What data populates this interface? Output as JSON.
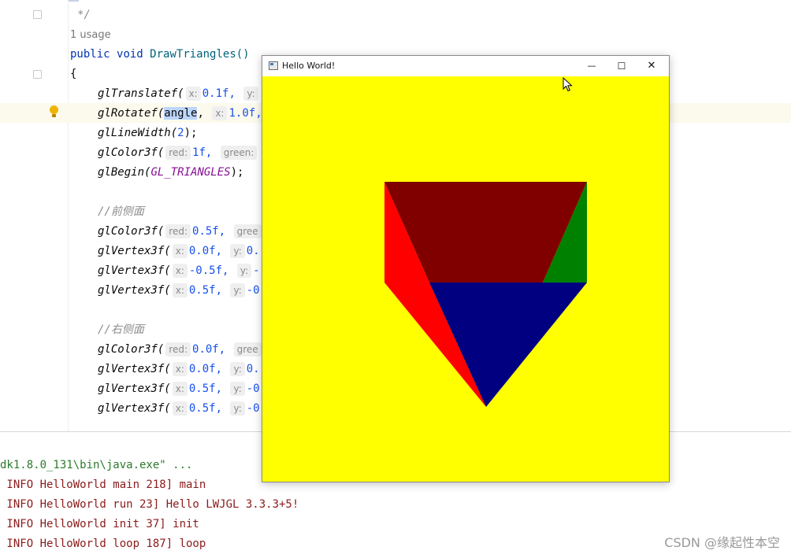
{
  "code": {
    "comment_close": "*/",
    "usage": "1 usage",
    "sig_public": "public",
    "sig_void": "void",
    "sig_name": "DrawTriangles()",
    "open_brace": "{",
    "l1_fn": "glTranslatef(",
    "l1_hint1": "x:",
    "l1_val1": "0.1f,",
    "l1_hint2": "y:",
    "l2_fn": "glRotatef(",
    "l2_arg": "angle",
    "l2_comma": ",",
    "l2_hint": "x:",
    "l2_val": "1.0f,",
    "l3_fn": "glLineWidth(",
    "l3_val": "2",
    "l3_end": ");",
    "l4_fn": "glColor3f(",
    "l4_hint1": "red:",
    "l4_val1": "1f,",
    "l4_hint2": "green:",
    "l5_fn": "glBegin(",
    "l5_const": "GL_TRIANGLES",
    "l5_end": ");",
    "c1": "//前侧面",
    "l6_fn": "glColor3f(",
    "l6_hint1": "red:",
    "l6_val1": "0.5f,",
    "l6_hint2": "gree",
    "l7_fn": "glVertex3f(",
    "l7_hint1": "x:",
    "l7_val1": "0.0f,",
    "l7_hint2": "y:",
    "l7_val2": "0.",
    "l8_fn": "glVertex3f(",
    "l8_hint1": "x:",
    "l8_val1": "-0.5f,",
    "l8_hint2": "y:",
    "l8_val2": "-",
    "l9_fn": "glVertex3f(",
    "l9_hint1": "x:",
    "l9_val1": "0.5f,",
    "l9_hint2": "y:",
    "l9_val2": "-0",
    "c2": "//右侧面",
    "l10_fn": "glColor3f(",
    "l10_hint1": "red:",
    "l10_val1": "0.0f,",
    "l10_hint2": "gree",
    "l11_fn": "glVertex3f(",
    "l11_hint1": "x:",
    "l11_val1": "0.0f,",
    "l11_hint2": "y:",
    "l11_val2": "0.",
    "l12_fn": "glVertex3f(",
    "l12_hint1": "x:",
    "l12_val1": "0.5f,",
    "l12_hint2": "y:",
    "l12_val2": "-0",
    "l13_fn": "glVertex3f(",
    "l13_hint1": "x:",
    "l13_val1": "0.5f,",
    "l13_hint2": "y:",
    "l13_val2": "-0"
  },
  "console": {
    "lines": [
      "dk1.8.0_131\\bin\\java.exe\" ...",
      " INFO HelloWorld main 218] main",
      " INFO HelloWorld run 23] Hello LWJGL 3.3.3+5!",
      " INFO HelloWorld init 37] init",
      " INFO HelloWorld loop 187] loop"
    ]
  },
  "window": {
    "title": "Hello World!",
    "minimize": "—",
    "maximize": "☐",
    "close": "✕"
  },
  "watermark": "CSDN @缘起性本空",
  "colors": {
    "background": "#ffff00",
    "dark_red": "#800000",
    "red": "#ff0000",
    "green": "#008000",
    "navy": "#000080"
  }
}
